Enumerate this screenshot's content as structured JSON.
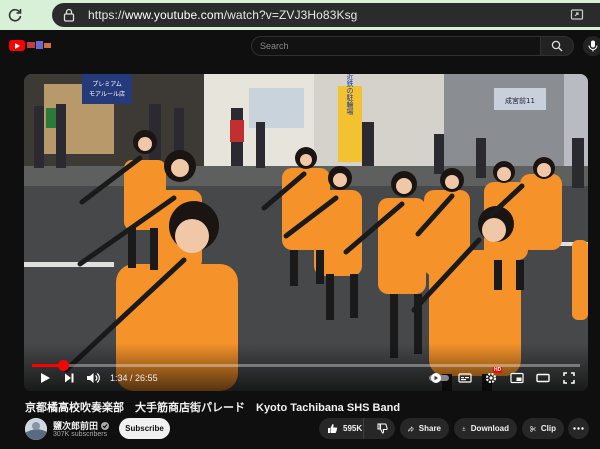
{
  "browser": {
    "url_prefix": "https://",
    "url_host": "www.youtube.com",
    "url_path": "/watch?v=ZVJ3Ho83Ksg",
    "icons": [
      "reload-icon",
      "lock-icon",
      "extension-icon"
    ]
  },
  "header": {
    "search_placeholder": "Search",
    "icons": [
      "youtube-logo-icon",
      "doodle-icon",
      "search-icon",
      "mic-icon"
    ]
  },
  "video": {
    "current_time": "1:34",
    "separator": " / ",
    "duration": "26:55",
    "progress_fraction": 0.058,
    "scene_signs": {
      "shop_left": [
        "プレミアム",
        "モアルール店"
      ],
      "banner_vertical": "近鉄の駐輪場",
      "station_sign": "成宮前11"
    },
    "controls": [
      "play-icon",
      "next-icon",
      "volume-icon",
      "autoplay-toggle",
      "subtitles-icon",
      "settings-icon",
      "miniplayer-icon",
      "theater-icon",
      "fullscreen-icon"
    ],
    "settings_badge": "HD"
  },
  "info": {
    "title": "京都橘高校吹奏楽部　大手筋商店街パレード　Kyoto Tachibana SHS Band",
    "channel_name": "鹽次郎前田",
    "subscribers": "307K subscribers",
    "subscribe_label": "Subscribe",
    "likes": "595K",
    "share_label": "Share",
    "download_label": "Download",
    "clip_label": "Clip"
  },
  "colors": {
    "accent": "#ff0000",
    "uniform_orange": "#f5922a",
    "browser_bar": "#d8f0d8"
  }
}
